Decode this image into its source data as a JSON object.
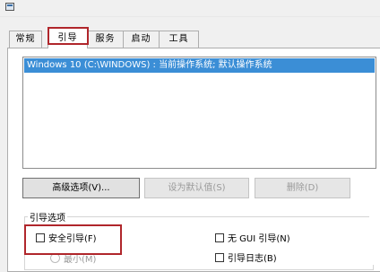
{
  "tabs": [
    {
      "label": "常规"
    },
    {
      "label": "引导"
    },
    {
      "label": "服务"
    },
    {
      "label": "启动"
    },
    {
      "label": "工具"
    }
  ],
  "boot_list": [
    {
      "label": "Windows 10 (C:\\WINDOWS) : 当前操作系统; 默认操作系统",
      "selected": true
    }
  ],
  "buttons": {
    "advanced": "高级选项(V)...",
    "set_default": "设为默认值(S)",
    "delete": "删除(D)"
  },
  "boot_options": {
    "title": "引导选项",
    "safe_boot": "安全引导(F)",
    "no_gui": "无 GUI 引导(N)",
    "boot_log": "引导日志(B)",
    "minimal": "最小(M)"
  },
  "colors": {
    "selection": "#3b8ed6",
    "annotation_red": "#b0262b"
  }
}
